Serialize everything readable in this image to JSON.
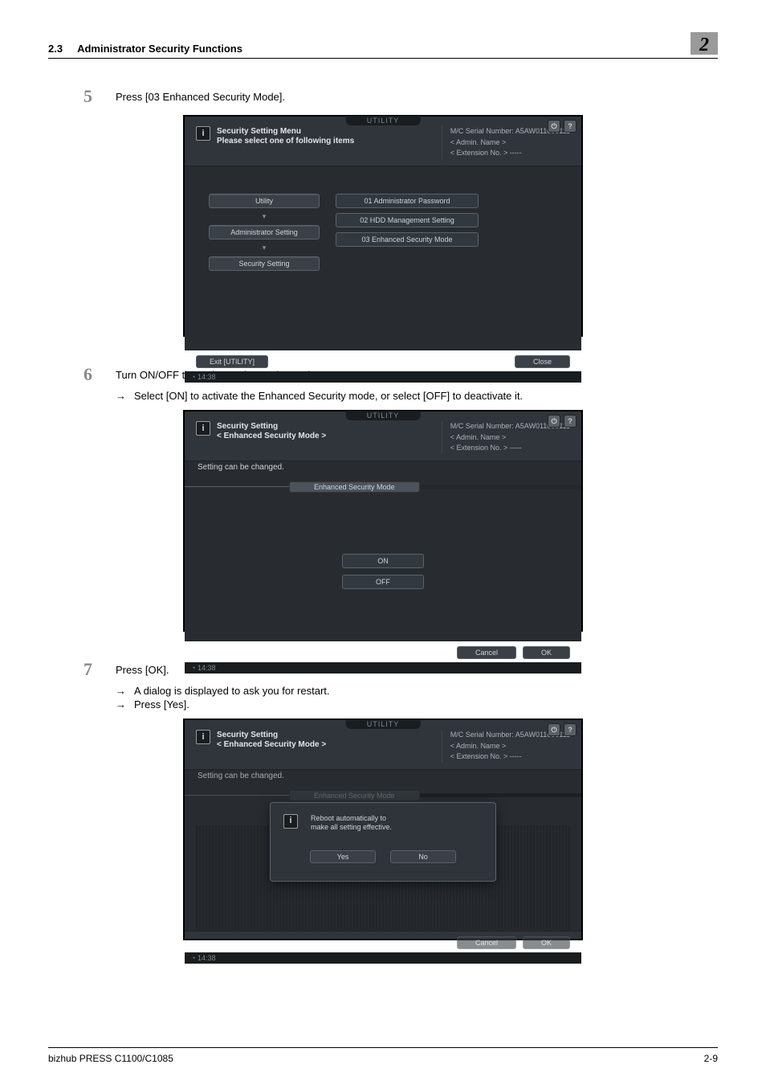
{
  "header": {
    "section_number": "2.3",
    "section_title": "Administrator Security Functions",
    "chapter": "2"
  },
  "steps": {
    "s5_num": "5",
    "s5_text": "Press [03 Enhanced Security Mode].",
    "s6_num": "6",
    "s6_text": "Turn ON/OFF the Enhanced Security mode.",
    "s6_sub": "Select [ON] to activate the Enhanced Security mode, or select [OFF] to deactivate it.",
    "s7_num": "7",
    "s7_text": "Press [OK].",
    "s7_sub1": "A dialog is displayed to ask you for restart.",
    "s7_sub2": "Press [Yes]."
  },
  "shot_common": {
    "tab_label": "UTILITY",
    "serial_line": "M/C Serial Number: A5AW011000111",
    "admin_line": "< Admin. Name >",
    "ext_line": "< Extension No. >  -----",
    "time": "14:38"
  },
  "shot1": {
    "title1": "Security Setting Menu",
    "title2": "Please select one of following items",
    "nav1": "Utility",
    "nav2": "Administrator Setting",
    "nav3": "Security Setting",
    "opt1": "01 Administrator Password",
    "opt2": "02 HDD Management Setting",
    "opt3": "03 Enhanced Security Mode",
    "exit": "Exit [UTILITY]",
    "close": "Close"
  },
  "shot2": {
    "title1": "Security Setting",
    "title2": "< Enhanced Security Mode >",
    "msg": "Setting can be changed.",
    "band": "Enhanced Security Mode",
    "on": "ON",
    "off": "OFF",
    "cancel": "Cancel",
    "ok": "OK"
  },
  "shot3": {
    "title1": "Security Setting",
    "title2": "< Enhanced Security Mode >",
    "msg": "Setting can be changed.",
    "band": "Enhanced Security Mode",
    "modal1": "Reboot automatically to",
    "modal2": "make all setting effective.",
    "yes": "Yes",
    "no": "No",
    "cancel": "Cancel",
    "ok": "OK"
  },
  "footer": {
    "left": "bizhub PRESS C1100/C1085",
    "right": "2-9"
  }
}
